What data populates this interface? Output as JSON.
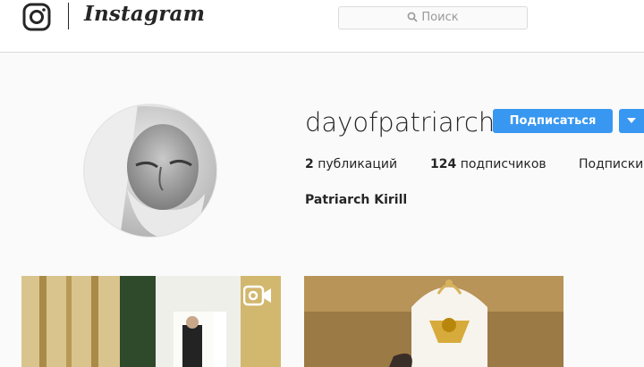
{
  "header": {
    "brand": "Instagram",
    "search": {
      "placeholder": "Поиск"
    }
  },
  "profile": {
    "username": "dayofpatriarch",
    "follow_label": "Подписаться",
    "full_name": "Patriarch Kirill",
    "stats": {
      "posts_count": "2",
      "posts_label": "публикаций",
      "followers_count": "124",
      "followers_label": "подписчиков",
      "following_label": "Подписки"
    }
  },
  "posts": [
    {
      "kind": "video",
      "icon": "video-camera-icon"
    },
    {
      "kind": "photo"
    }
  ],
  "colors": {
    "accent": "#3897f0",
    "text": "#262626",
    "muted": "#999999",
    "background": "#fafafa"
  }
}
